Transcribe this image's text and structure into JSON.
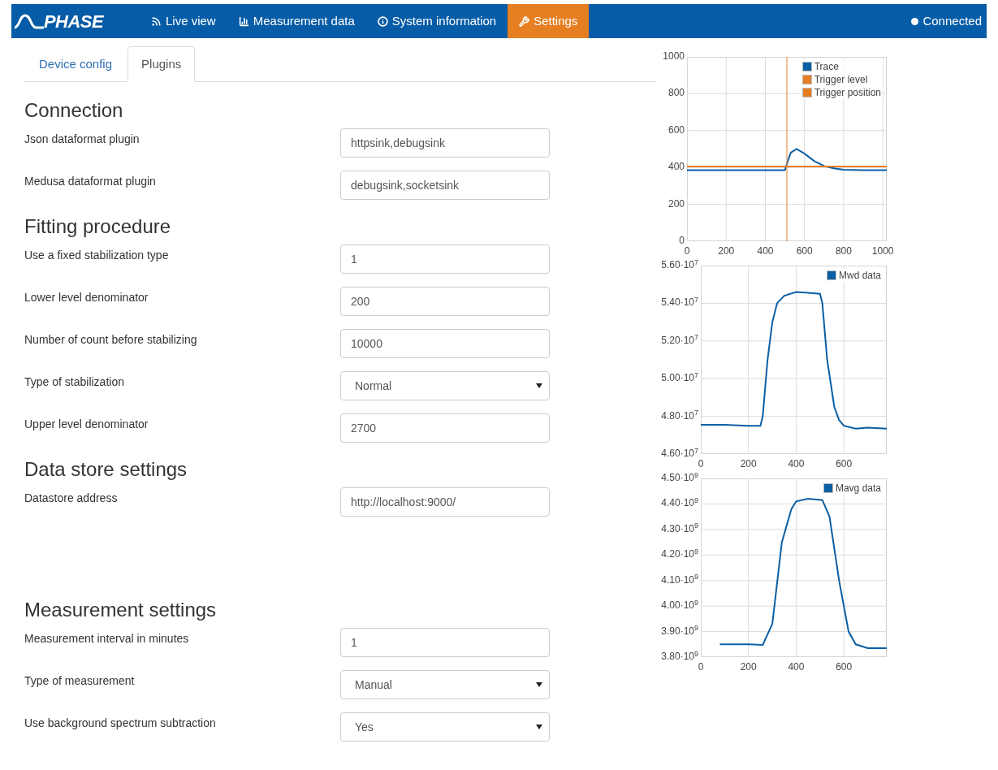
{
  "navbar": {
    "brand": "PHASE",
    "items": [
      {
        "label": "Live view",
        "selected": false
      },
      {
        "label": "Measurement data",
        "selected": false
      },
      {
        "label": "System information",
        "selected": false
      },
      {
        "label": "Settings",
        "selected": true
      }
    ],
    "status": "Connected"
  },
  "tabs": [
    {
      "label": "Device config",
      "selected": false
    },
    {
      "label": "Plugins",
      "selected": true
    }
  ],
  "sections": [
    {
      "title": "Connection",
      "fields": [
        {
          "label": "Json dataformat plugin",
          "kind": "text",
          "value": "httpsink,debugsink"
        },
        {
          "label": "Medusa dataformat plugin",
          "kind": "text",
          "value": "debugsink,socketsink"
        }
      ]
    },
    {
      "title": "Fitting procedure",
      "fields": [
        {
          "label": "Use a fixed stabilization type",
          "kind": "text",
          "value": "1"
        },
        {
          "label": "Lower level denominator",
          "kind": "text",
          "value": "200"
        },
        {
          "label": "Number of count before stabilizing",
          "kind": "text",
          "value": "10000"
        },
        {
          "label": "Type of stabilization",
          "kind": "select",
          "value": "Normal"
        },
        {
          "label": "Upper level denominator",
          "kind": "text",
          "value": "2700"
        }
      ]
    },
    {
      "title": "Data store settings",
      "fields": [
        {
          "label": "Datastore address",
          "kind": "text",
          "value": "http://localhost:9000/"
        }
      ]
    },
    {
      "title": "Measurement settings",
      "fields": [
        {
          "label": "Measurement interval in minutes",
          "kind": "text",
          "value": "1"
        },
        {
          "label": "Type of measurement",
          "kind": "select",
          "value": "Manual"
        },
        {
          "label": "Use background spectrum subtraction",
          "kind": "select",
          "value": "Yes"
        }
      ]
    }
  ],
  "charts": [
    {
      "chart_data": {
        "type": "line",
        "grid": true,
        "legend": true,
        "x": [
          0,
          100,
          200,
          300,
          400,
          500,
          510,
          530,
          560,
          600,
          650,
          700,
          750,
          800,
          900,
          1020
        ],
        "xlim": [
          0,
          1020
        ],
        "ylim": [
          0,
          1000
        ],
        "xticks": [
          0,
          200,
          400,
          600,
          800,
          1000
        ],
        "yticks": [
          0,
          200,
          400,
          600,
          800,
          1000
        ],
        "series": [
          {
            "name": "Trace",
            "color": "#0b5fa5",
            "values": [
              385,
              385,
              385,
              385,
              385,
              385,
              420,
              480,
              500,
              475,
              435,
              408,
              395,
              388,
              385,
              385
            ]
          },
          {
            "name": "Trigger level",
            "color": "#e67e22",
            "values": [
              405,
              405,
              405,
              405,
              405,
              405,
              405,
              405,
              405,
              405,
              405,
              405,
              405,
              405,
              405,
              405
            ]
          },
          {
            "name": "Trigger position",
            "color": "#e67e22",
            "x": [
              510,
              510
            ],
            "values": [
              0,
              1000
            ]
          }
        ]
      }
    },
    {
      "chart_data": {
        "type": "line",
        "grid": true,
        "legend": true,
        "x": [
          0,
          100,
          200,
          250,
          260,
          280,
          300,
          320,
          350,
          400,
          450,
          500,
          510,
          530,
          560,
          580,
          600,
          650,
          700,
          780
        ],
        "xlim": [
          0,
          780
        ],
        "ylim": [
          46000000,
          56000000
        ],
        "xticks": [
          0,
          200,
          400,
          600
        ],
        "yticks": [
          {
            "value": 46000000,
            "label": "4.60·10$^{7}$"
          },
          {
            "value": 48000000,
            "label": "4.80·10$^{7}$"
          },
          {
            "value": 50000000,
            "label": "5.00·10$^{7}$"
          },
          {
            "value": 52000000,
            "label": "5.20·10$^{7}$"
          },
          {
            "value": 54000000,
            "label": "5.40·10$^{7}$"
          },
          {
            "value": 56000000,
            "label": "5.60·10$^{7}$"
          }
        ],
        "series": [
          {
            "name": "Mwd data",
            "color": "#0b5fa5",
            "values": [
              47550000,
              47550000,
              47500000,
              47500000,
              48000000,
              51000000,
              53000000,
              54000000,
              54400000,
              54600000,
              54550000,
              54500000,
              54000000,
              51000000,
              48500000,
              47800000,
              47500000,
              47350000,
              47400000,
              47350000
            ]
          }
        ]
      }
    },
    {
      "chart_data": {
        "type": "line",
        "grid": true,
        "legend": true,
        "x": [
          80,
          200,
          260,
          300,
          340,
          380,
          400,
          450,
          510,
          540,
          580,
          620,
          650,
          700,
          780
        ],
        "xlim": [
          0,
          780
        ],
        "ylim": [
          3800000000,
          4500000000
        ],
        "xticks": [
          0,
          200,
          400,
          600
        ],
        "yticks": [
          {
            "value": 3800000000,
            "label": "3.80·10$^{9}$"
          },
          {
            "value": 3900000000,
            "label": "3.90·10$^{9}$"
          },
          {
            "value": 4000000000,
            "label": "4.00·10$^{9}$"
          },
          {
            "value": 4100000000,
            "label": "4.10·10$^{9}$"
          },
          {
            "value": 4200000000,
            "label": "4.20·10$^{9}$"
          },
          {
            "value": 4300000000,
            "label": "4.30·10$^{9}$"
          },
          {
            "value": 4400000000,
            "label": "4.40·10$^{9}$"
          },
          {
            "value": 4500000000,
            "label": "4.50·10$^{9}$"
          }
        ],
        "series": [
          {
            "name": "Mavg data",
            "color": "#0b5fa5",
            "values": [
              3850000000,
              3850000000,
              3848000000,
              3930000000,
              4250000000,
              4380000000,
              4410000000,
              4420000000,
              4415000000,
              4350000000,
              4100000000,
              3900000000,
              3850000000,
              3835000000,
              3835000000
            ]
          }
        ]
      }
    }
  ]
}
